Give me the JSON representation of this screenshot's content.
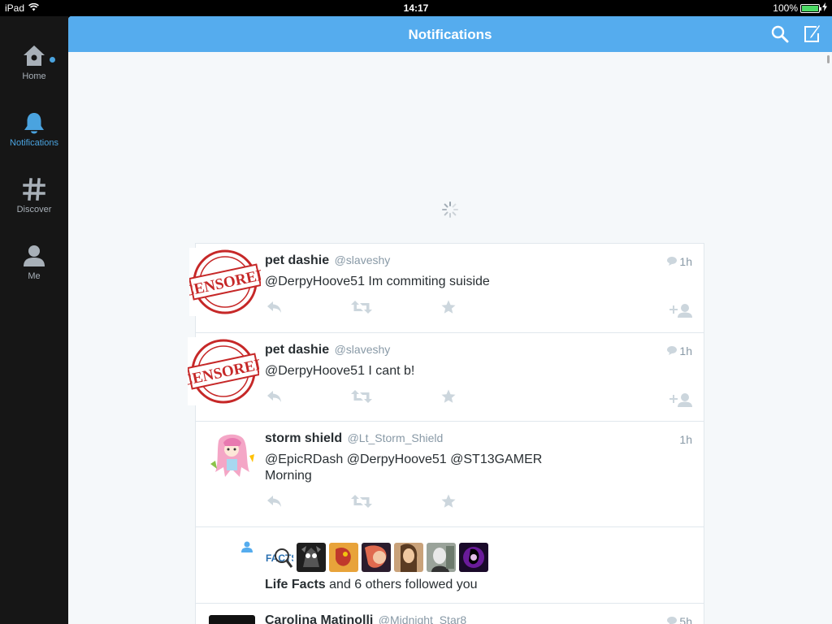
{
  "status_bar": {
    "device": "iPad",
    "time": "14:17",
    "battery": "100%"
  },
  "sidebar": {
    "items": [
      {
        "label": "Home",
        "icon": "home-icon"
      },
      {
        "label": "Notifications",
        "icon": "bell-icon"
      },
      {
        "label": "Discover",
        "icon": "hashtag-icon"
      },
      {
        "label": "Me",
        "icon": "person-icon"
      }
    ]
  },
  "header": {
    "title": "Notifications"
  },
  "colors": {
    "accent": "#55acee",
    "sidebar_active": "#4aa3df"
  },
  "feed": {
    "tweets": [
      {
        "name": "pet dashie",
        "handle": "@slaveshy",
        "time": "1h",
        "text": "@DerpyHoove51 Im commiting suiside",
        "avatar_stamp": "CENSORED"
      },
      {
        "name": "pet dashie",
        "handle": "@slaveshy",
        "time": "1h",
        "text": "@DerpyHoove51 I cant b!",
        "avatar_stamp": "CENSORED"
      },
      {
        "name": "storm shield",
        "handle": "@Lt_Storm_Shield",
        "time": "1h",
        "text_line1": "@EpicRDash @DerpyHoove51 @ST13GAMER",
        "text_line2": "Morning"
      }
    ],
    "follow": {
      "name": "Life Facts",
      "rest": "and 6 others followed you",
      "facts_logo": "FACTS"
    },
    "partial_tweet": {
      "name": "Carolina Matinolli",
      "handle": "@Midnight_Star8",
      "time": "5h"
    }
  }
}
